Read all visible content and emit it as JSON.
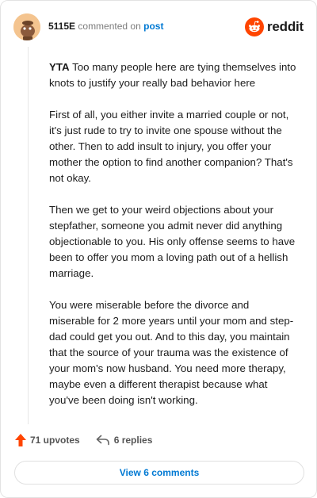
{
  "header": {
    "username": "5115E",
    "action_text": "commented on",
    "post_link": "post",
    "brand": "reddit",
    "brand_color": "#ff4500"
  },
  "comment": {
    "verdict": "YTA",
    "first_line": "Too many people here are tying themselves into knots to justify your really bad behavior here",
    "paragraphs": [
      "First of all, you either invite a married couple or not, it's just rude to try to invite one spouse without the other. Then to add insult to injury, you offer your mother the option to find another companion? That's not okay.",
      "Then we get to your weird objections about your stepfather, someone you admit never did anything objectionable to you. His only offense seems to have been to offer you mom a loving path out of a hellish marriage.",
      "You were miserable before the divorce and miserable for 2 more years until your mom and step-dad could get you out. And to this day, you maintain that the source of your trauma was the existence of your mom's now husband. You need more therapy, maybe even a different therapist because what you've been doing isn't working."
    ]
  },
  "actions": {
    "upvotes": "71 upvotes",
    "replies": "6 replies",
    "upvote_icon": "upvote-arrow-icon",
    "reply_icon": "reply-arrow-icon",
    "upvote_color": "#ff4500"
  },
  "footer": {
    "view_comments": "View 6 comments"
  }
}
